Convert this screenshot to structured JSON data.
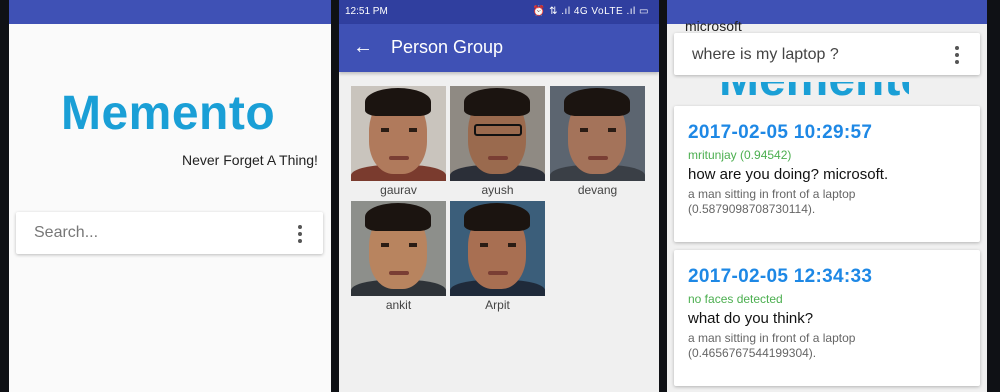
{
  "home": {
    "logo_text": "Memento",
    "tagline": "Never Forget A Thing!",
    "search_placeholder": "Search..."
  },
  "person_group": {
    "status_time": "12:51 PM",
    "status_right": "⏰ ⇅ .ıl 4G VoLTE .ıl ▭",
    "title": "Person Group",
    "people": [
      {
        "name": "gaurav",
        "skin": "#b07a5c",
        "shirt": "#7a3b2e",
        "bg": "#c9c4bd"
      },
      {
        "name": "ayush",
        "skin": "#9a6a4e",
        "shirt": "#2b2f38",
        "bg": "#8f8a83"
      },
      {
        "name": "devang",
        "skin": "#a4735a",
        "shirt": "#3a3f46",
        "bg": "#5c6570"
      },
      {
        "name": "ankit",
        "skin": "#b8845f",
        "shirt": "#2e3338",
        "bg": "#8d8f8b"
      },
      {
        "name": "Arpit",
        "skin": "#a86f52",
        "shirt": "#1f2a3a",
        "bg": "#3b5e7a"
      }
    ]
  },
  "results": {
    "background_text": "microsoft",
    "search_value": "where is my laptop ?",
    "cards": [
      {
        "timestamp": "2017-02-05 10:29:57",
        "faces": "mritunjay (0.94542)",
        "speech": "how are you doing? microsoft.",
        "caption": "a man sitting in front of a laptop (0.5879098708730114)."
      },
      {
        "timestamp": "2017-02-05 12:34:33",
        "faces": "no faces detected",
        "speech": "what do you think?",
        "caption": "a man sitting in front of a laptop (0.4656767544199304)."
      }
    ]
  },
  "colors": {
    "primary": "#3f51b5",
    "primary_dark": "#303f9f",
    "logo": "#1a9fd6",
    "timestamp": "#1e88e5",
    "faces": "#4caf50"
  },
  "icons": [
    "back-arrow-icon",
    "more-vert-icon",
    "alarm-icon",
    "signal-icon",
    "battery-icon"
  ]
}
